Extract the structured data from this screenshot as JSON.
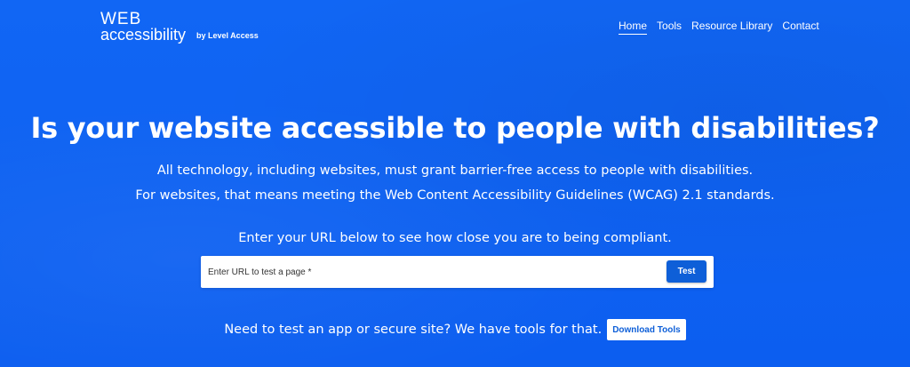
{
  "header": {
    "logo": {
      "line1": "WEB",
      "line2": "accessibility",
      "byline": "by Level Access"
    },
    "nav": [
      {
        "label": "Home",
        "active": true
      },
      {
        "label": "Tools",
        "active": false
      },
      {
        "label": "Resource Library",
        "active": false
      },
      {
        "label": "Contact",
        "active": false
      }
    ]
  },
  "hero": {
    "headline": "Is your website accessible to people with disabilities?",
    "subline1": "All technology, including websites, must grant barrier-free access to people with disabilities.",
    "subline2": "For websites, that means meeting the Web Content Accessibility Guidelines (WCAG) 2.1 standards.",
    "prompt": "Enter your URL below to see how close you are to being compliant."
  },
  "url_form": {
    "placeholder": "Enter URL to test a page *",
    "value": "",
    "button_label": "Test"
  },
  "tools": {
    "text": "Need to test an app or secure site? We have tools for that.",
    "button_label": "Download Tools"
  },
  "colors": {
    "background": "#0f5ff0",
    "button_blue": "#0e5fd8",
    "text": "#ffffff"
  }
}
